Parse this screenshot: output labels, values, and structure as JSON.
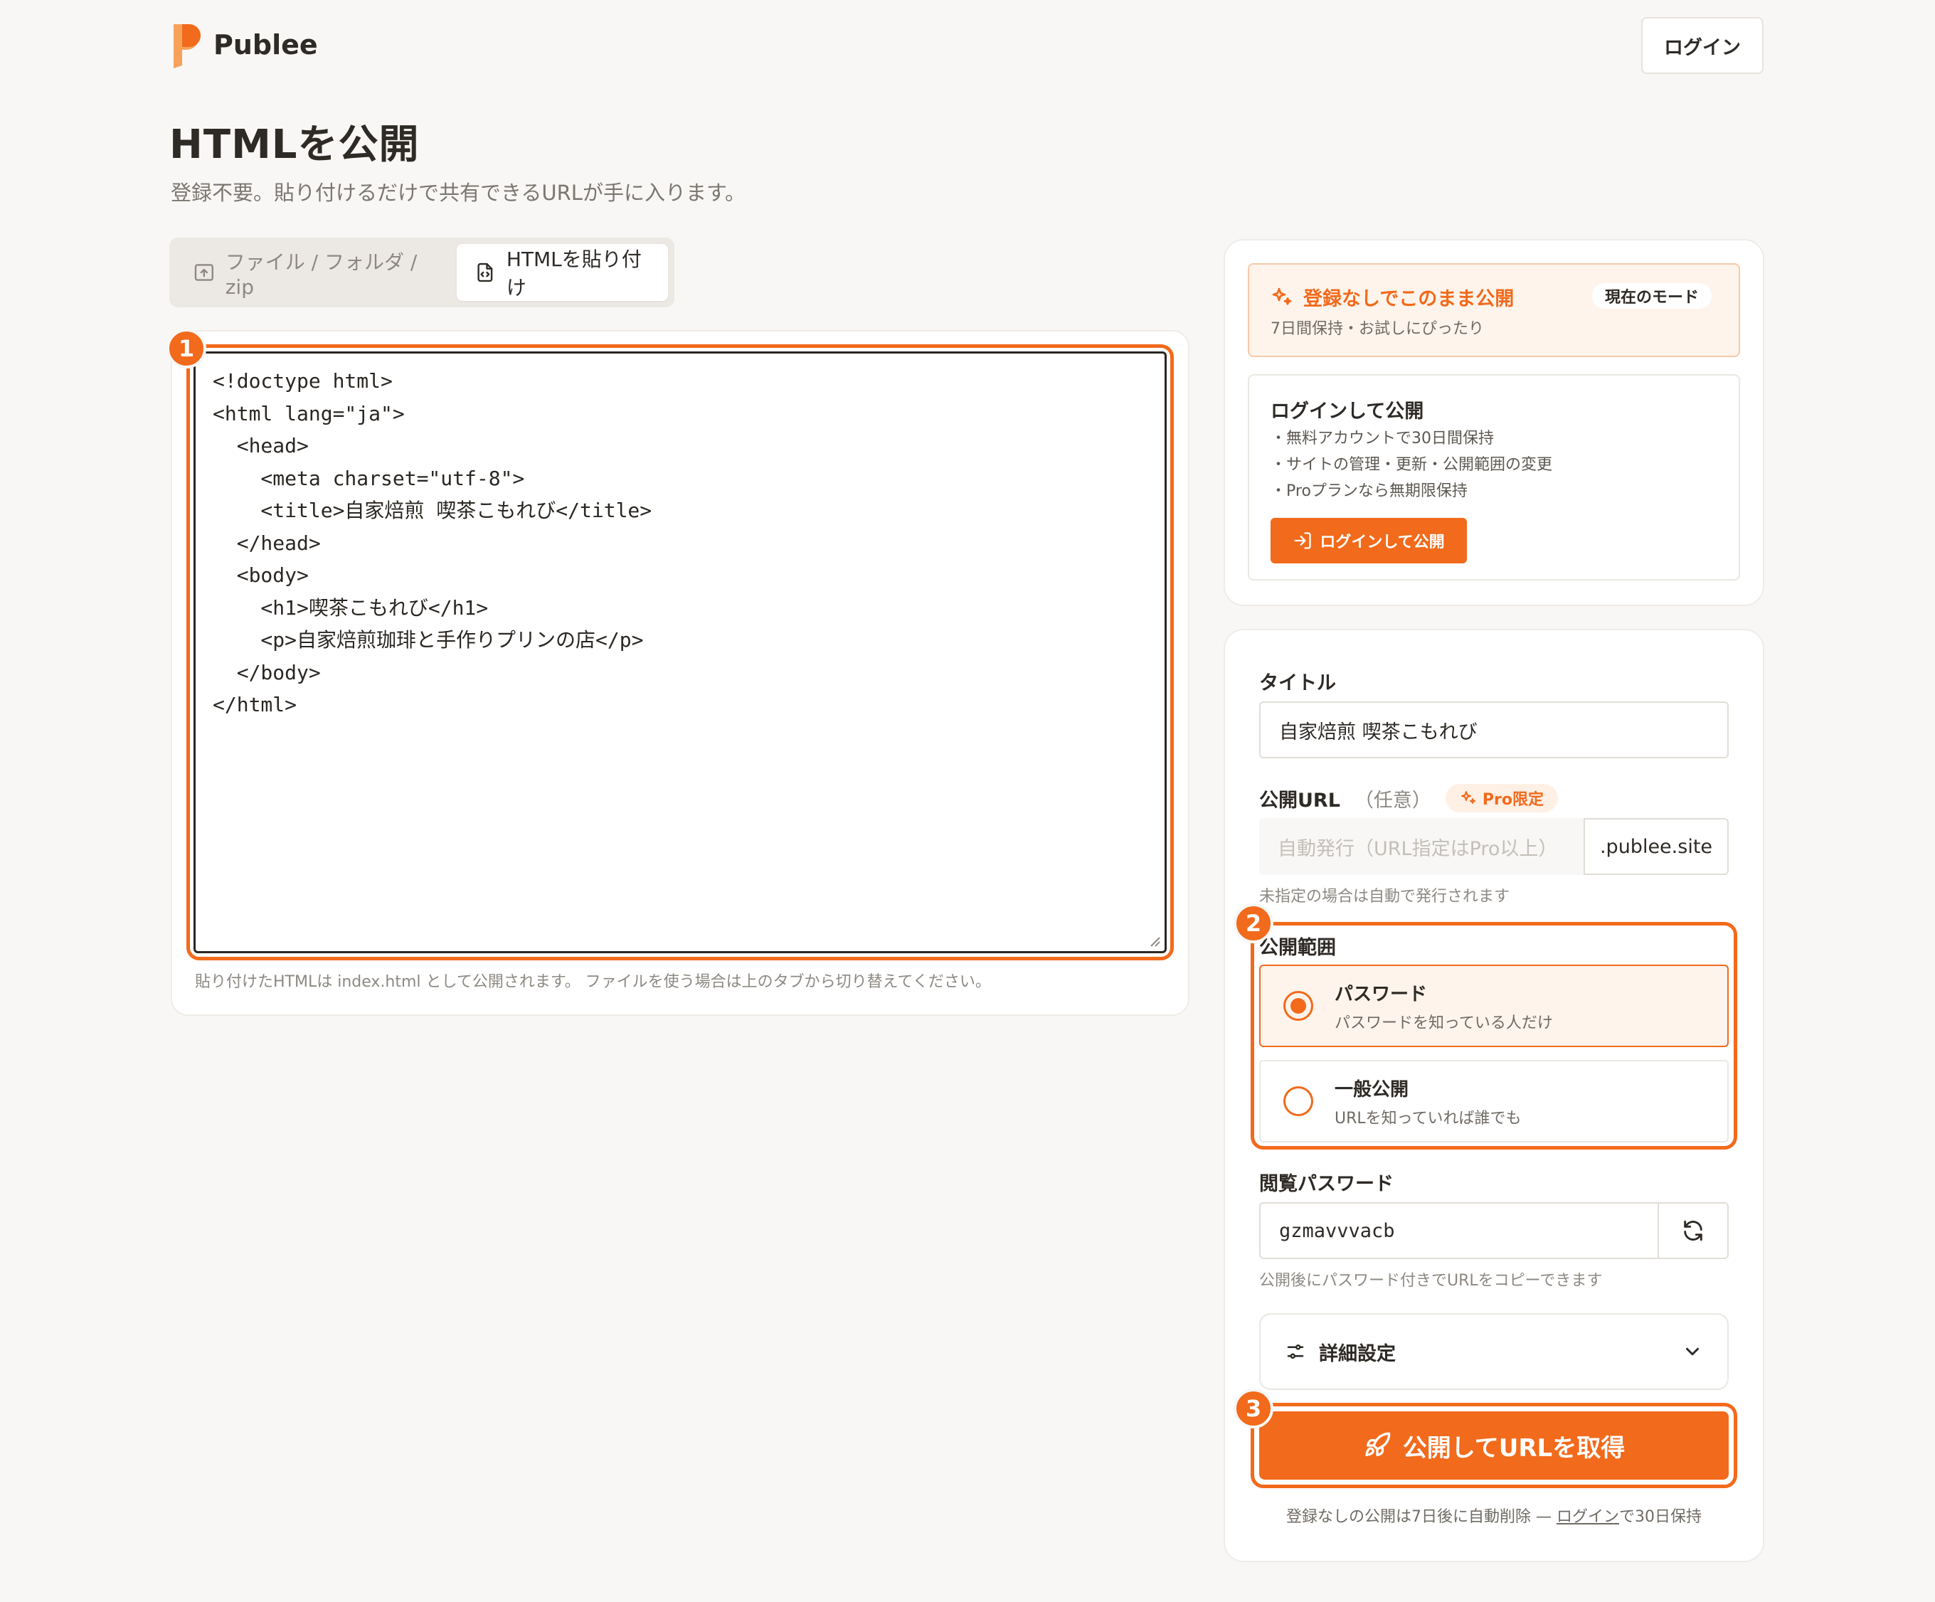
{
  "brand": {
    "name": "Publee"
  },
  "header": {
    "login_label": "ログイン"
  },
  "page": {
    "title": "HTMLを公開",
    "subtitle": "登録不要。貼り付けるだけで共有できるURLが手に入ります。"
  },
  "tabs": [
    {
      "label": "ファイル / フォルダ / zip",
      "active": false
    },
    {
      "label": "HTMLを貼り付け",
      "active": true
    }
  ],
  "editor": {
    "content": "<!doctype html>\n<html lang=\"ja\">\n  <head>\n    <meta charset=\"utf-8\">\n    <title>自家焙煎 喫茶こもれび</title>\n  </head>\n  <body>\n    <h1>喫茶こもれび</h1>\n    <p>自家焙煎珈琲と手作りプリンの店</p>\n  </body>\n</html>",
    "note": "貼り付けたHTMLは index.html として公開されます。 ファイルを使う場合は上のタブから切り替えてください。"
  },
  "badges": {
    "one": "1",
    "two": "2",
    "three": "3"
  },
  "mode": {
    "current_title": "登録なしでこのまま公開",
    "current_desc": "7日間保持・お試しにぴったり",
    "current_pill": "現在のモード",
    "login_title": "ログインして公開",
    "login_points": [
      "・無料アカウントで30日間保持",
      "・サイトの管理・更新・公開範囲の変更",
      "・Proプランなら無期限保持"
    ],
    "login_button": "ログインして公開"
  },
  "form": {
    "title_label": "タイトル",
    "title_value": "自家焙煎 喫茶こもれび",
    "url_label": "公開URL",
    "url_optional": "（任意）",
    "url_pro": "Pro限定",
    "url_placeholder": "自動発行（URL指定はPro以上）",
    "url_suffix": ".publee.site",
    "url_hint": "未指定の場合は自動で発行されます",
    "visibility_label": "公開範囲",
    "visibility_options": [
      {
        "name": "パスワード",
        "desc": "パスワードを知っている人だけ",
        "selected": true
      },
      {
        "name": "一般公開",
        "desc": "URLを知っていれば誰でも",
        "selected": false
      }
    ],
    "password_label": "閲覧パスワード",
    "password_value": "gzmavvvacb",
    "password_hint": "公開後にパスワード付きでURLをコピーできます",
    "advanced_label": "詳細設定",
    "publish_button": "公開してURLを取得",
    "publish_note_pre": "登録なしの公開は7日後に自動削除 — ",
    "publish_note_link": "ログイン",
    "publish_note_post": "で30日保持"
  },
  "colors": {
    "accent": "#f26a1b",
    "background": "#f8f7f5",
    "text": "#2e2a26"
  }
}
